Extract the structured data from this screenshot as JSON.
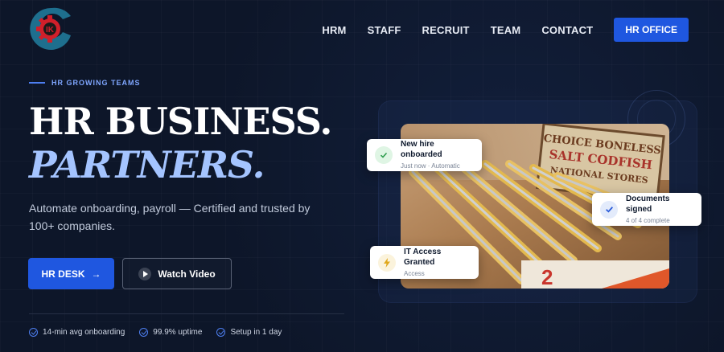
{
  "brand": {
    "logo_letters": "IK"
  },
  "nav": {
    "items": [
      "HRM",
      "STAFF",
      "RECRUIT",
      "TEAM",
      "CONTACT"
    ],
    "cta_label": "HR OFFICE"
  },
  "hero": {
    "eyebrow": "HR GROWING TEAMS",
    "title_line1": "HR BUSINESS.",
    "title_line2": "PARTNERS.",
    "subtitle": "Automate onboarding, payroll — Certified and trusted by 100+ companies.",
    "primary_button": "HR DESK",
    "primary_arrow": "→",
    "secondary_button": "Watch Video"
  },
  "badges": [
    "14-min avg onboarding",
    "99.9% uptime",
    "Setup in 1 day"
  ],
  "photo": {
    "sign_line1": "CHOICE BONELESS",
    "sign_line2": "SALT CODFISH",
    "sign_line3": "NATIONAL STORES"
  },
  "toasts": {
    "new_hire": {
      "title": "New hire onboarded",
      "subtitle": "Just now · Automatic"
    },
    "documents": {
      "title": "Documents signed",
      "subtitle": "4 of 4 complete"
    },
    "it_access": {
      "title": "IT Access Granted",
      "subtitle": "Access"
    }
  },
  "colors": {
    "background": "#0d1629",
    "accent": "#1f57e0",
    "title_italic": "#a4c4ff",
    "logo_red": "#d01f2a",
    "logo_blue": "#1e6f8e"
  }
}
